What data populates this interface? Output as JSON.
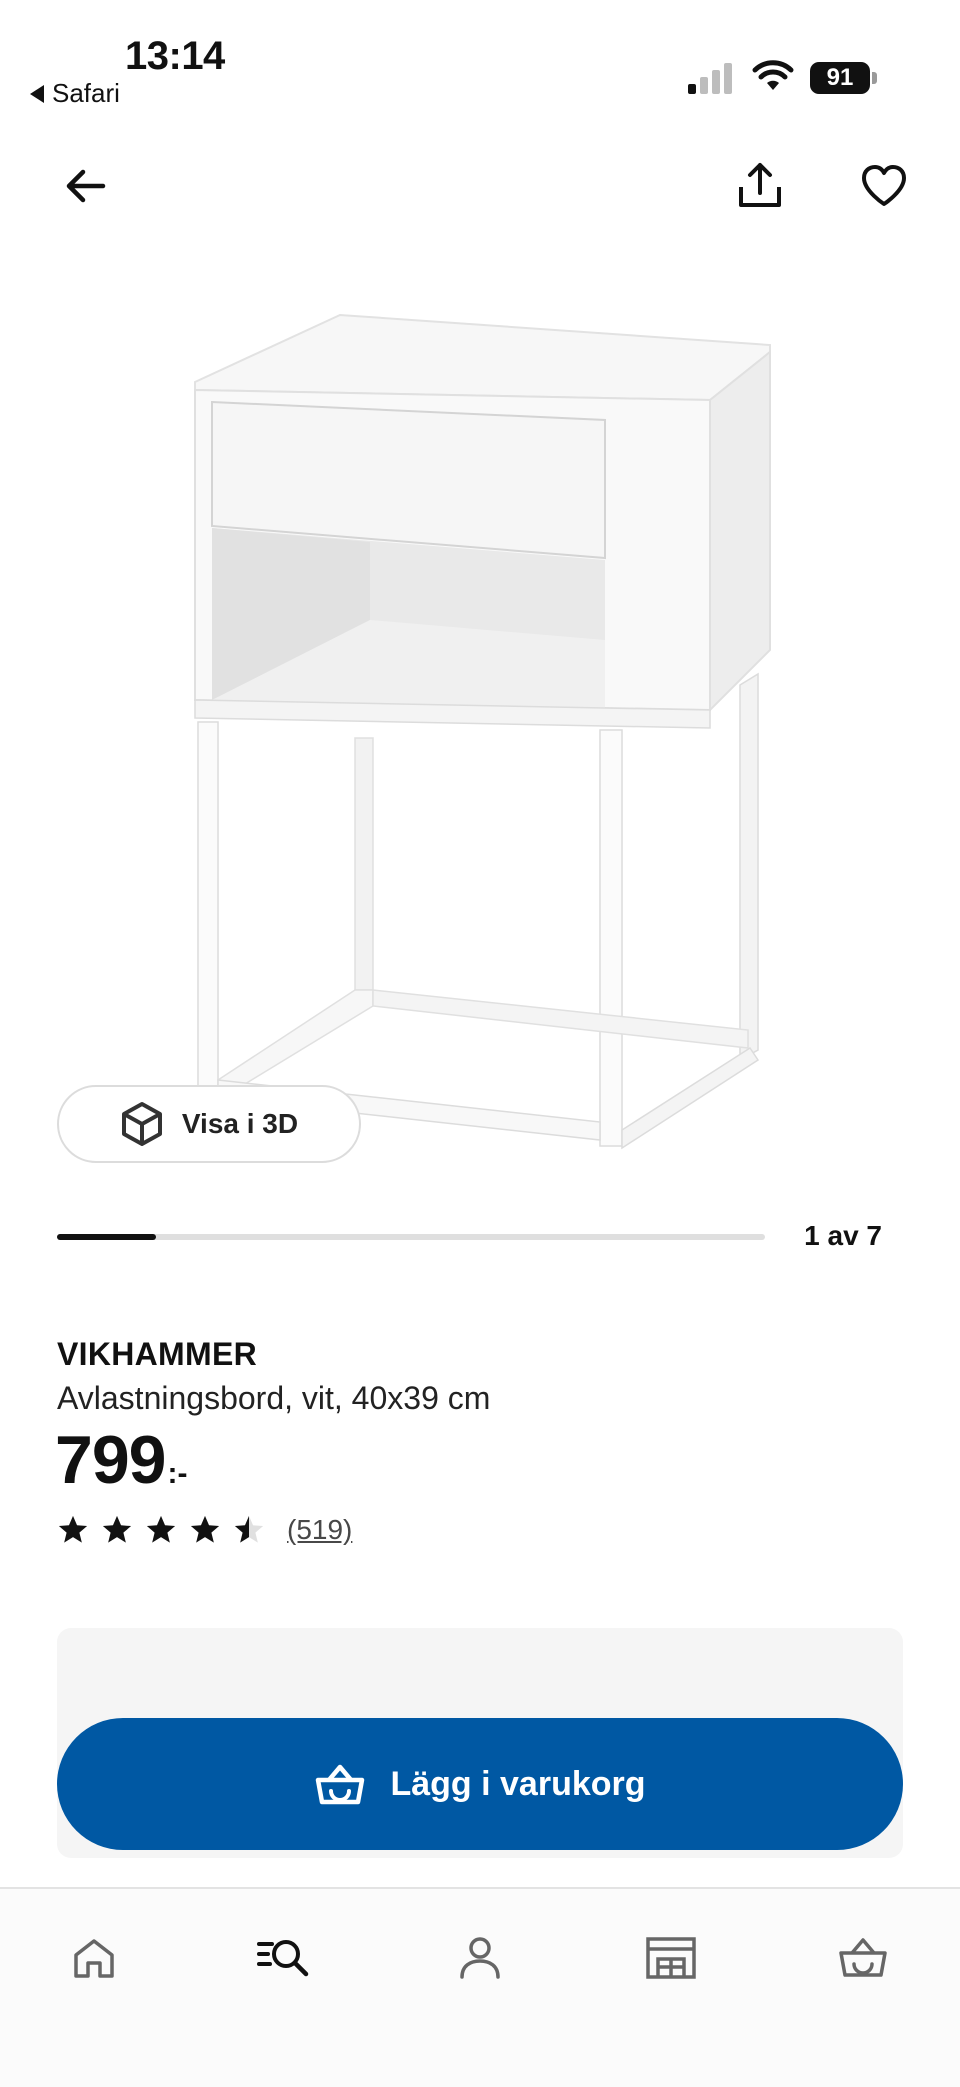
{
  "status_bar": {
    "time": "13:14",
    "back_app": "Safari",
    "battery": "91"
  },
  "top_nav": {
    "icons": [
      "arrow-left-icon",
      "share-icon",
      "heart-icon"
    ]
  },
  "product": {
    "view_3d_label": "Visa i 3D",
    "gallery": {
      "current_label": "1 av 7",
      "progress": 0.14
    },
    "name": "VIKHAMMER",
    "description": "Avlastningsbord, vit, 40x39 cm",
    "price": "799",
    "price_suffix": ":-",
    "rating": {
      "stars": 4.5,
      "count_label": "(519)"
    }
  },
  "cart": {
    "button_label": "Lägg i varukorg",
    "color": "#0058a3"
  },
  "tab_bar": {
    "tabs": [
      {
        "icon": "home-icon",
        "active": false
      },
      {
        "icon": "search-icon",
        "active": true
      },
      {
        "icon": "profile-icon",
        "active": false
      },
      {
        "icon": "store-icon",
        "active": false
      },
      {
        "icon": "basket-icon",
        "active": false
      }
    ]
  }
}
